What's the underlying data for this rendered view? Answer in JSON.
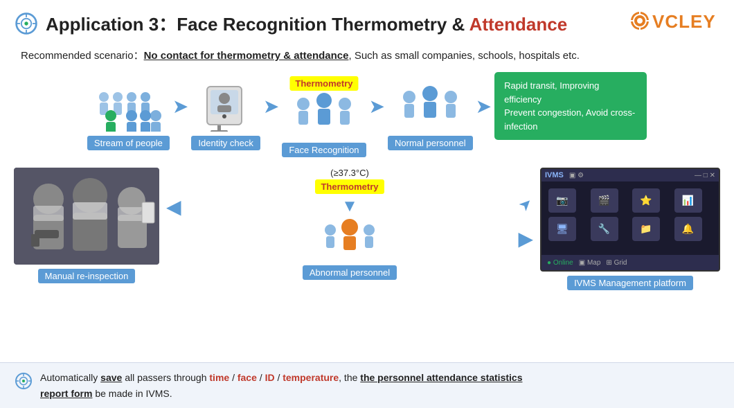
{
  "header": {
    "icon_alt": "target-crosshair-icon",
    "title_prefix": "Application 3：",
    "title_middle": "Face Recognition Thermometry & ",
    "title_highlight": "Attendance",
    "logo_text": "VCLEY"
  },
  "scenario": {
    "label": "Recommended scenario：",
    "highlight": "No contact for thermometry & attendance",
    "rest": ",  Such as small companies, schools, hospitals etc."
  },
  "flow": {
    "nodes": [
      {
        "id": "stream",
        "label": "Stream of people"
      },
      {
        "id": "identity",
        "label": "Identity check"
      },
      {
        "id": "face_recognition",
        "label": "Face Recognition"
      },
      {
        "id": "normal",
        "label": "Normal personnel"
      }
    ],
    "thermometry_badge": "Thermometry",
    "green_box_line1": "Rapid transit, Improving efficiency",
    "green_box_line2": "Prevent congestion, Avoid cross-infection",
    "temp_label": "(≥37.3°C)",
    "thermometry_badge2": "Thermometry",
    "abnormal_label": "Abnormal personnel",
    "manual_label": "Manual re-inspection",
    "ivms_label": "IVMS Management platform"
  },
  "bottom": {
    "text_1": "Automatically ",
    "save_bold": "save",
    "text_2": " all passers through ",
    "time": "time",
    "slash1": " / ",
    "face": "face",
    "slash2": " / ",
    "id": "ID",
    "slash3": " / ",
    "temperature": "temperature",
    "comma": ",  the ",
    "stats_underline": "the personnel attendance statistics",
    "report_underline": "report form",
    "text_end": " be made in IVMS."
  }
}
